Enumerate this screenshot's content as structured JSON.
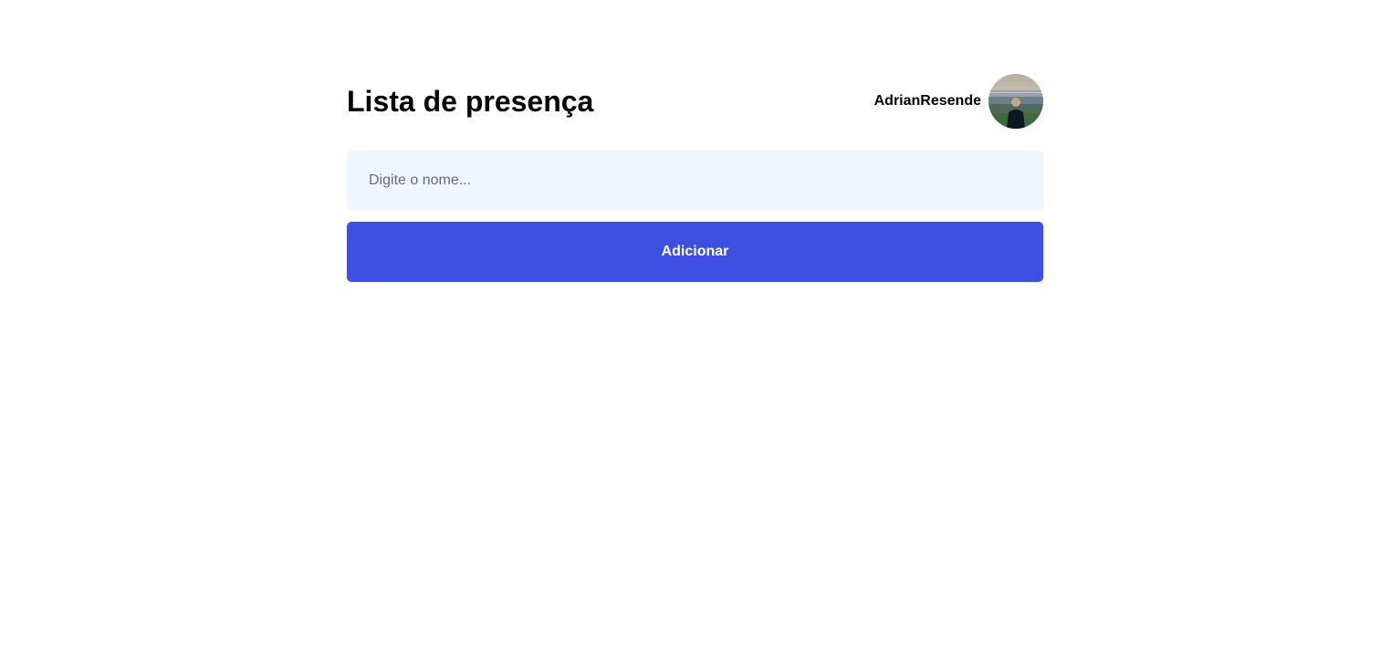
{
  "header": {
    "title": "Lista de presença",
    "user": {
      "name": "AdrianResende",
      "avatar_icon": "user-avatar-photo"
    }
  },
  "form": {
    "name_input": {
      "placeholder": "Digite o nome...",
      "value": ""
    },
    "add_button_label": "Adicionar"
  },
  "colors": {
    "input_background": "#eff6fe",
    "button_background": "#3e4fe2",
    "button_text": "#ffffff",
    "page_background": "#ffffff"
  }
}
